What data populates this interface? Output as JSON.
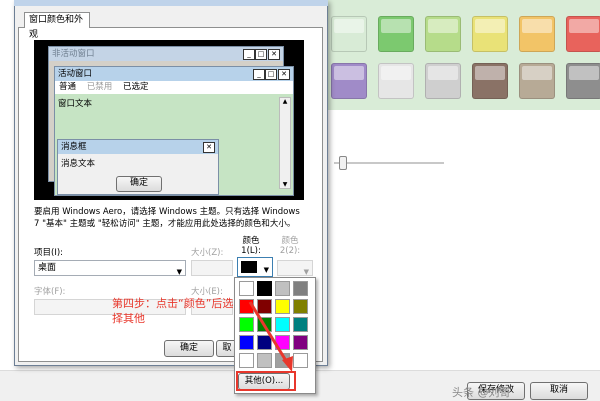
{
  "dialog": {
    "tab_label": "窗口颜色和外观",
    "preview": {
      "inactive_title": "非活动窗口",
      "active_title": "活动窗口",
      "menu": [
        "普通",
        "已禁用",
        "已选定"
      ],
      "window_text": "窗口文本",
      "msgbox_title": "消息框",
      "msgbox_text": "消息文本",
      "ok_label": "确定"
    },
    "description": "要启用 Windows Aero，请选择 Windows 主题。只有选择 Windows 7 \"基本\" 主题或 \"轻松访问\" 主题，才能应用此处选择的颜色和大小。",
    "item_label": "项目(I):",
    "item_value": "桌面",
    "size_label": "大小(Z):",
    "color1_label": "颜色 1(L):",
    "color2_label": "颜色 2(2):",
    "font_label": "字体(F):",
    "font_size_label": "大小(E):",
    "color_label": "颜色",
    "ok_button": "确定",
    "cancel_button_partial": "取"
  },
  "palette": {
    "selected": "#000000",
    "colors": [
      "#ffffff",
      "#000000",
      "#c0c0c0",
      "#808080",
      "#ff0000",
      "#800000",
      "#ffff00",
      "#808000",
      "#00ff00",
      "#008000",
      "#00ffff",
      "#008080",
      "#0000ff",
      "#000080",
      "#ff00ff",
      "#800080",
      "#ffffff",
      "#c0c0c0",
      "#a0a0a0",
      "#ffffff"
    ],
    "other_button": "其他(O)..."
  },
  "annotation": "第四步：点击“颜色”后选择其他",
  "background_window": {
    "swatches_row1": [
      "#d8ebd6",
      "#7cc96f",
      "#b6dc8a",
      "#e9e277",
      "#f2c467",
      "#e8635c"
    ],
    "swatches_row2": [
      "#a08bc8",
      "#e6e6e6",
      "#cfcfcf",
      "#8a7266",
      "#b7aa96",
      "#8e8e8e"
    ],
    "save_button": "保存修改",
    "cancel_button": "取消"
  },
  "watermark": "头条 @刘哥"
}
